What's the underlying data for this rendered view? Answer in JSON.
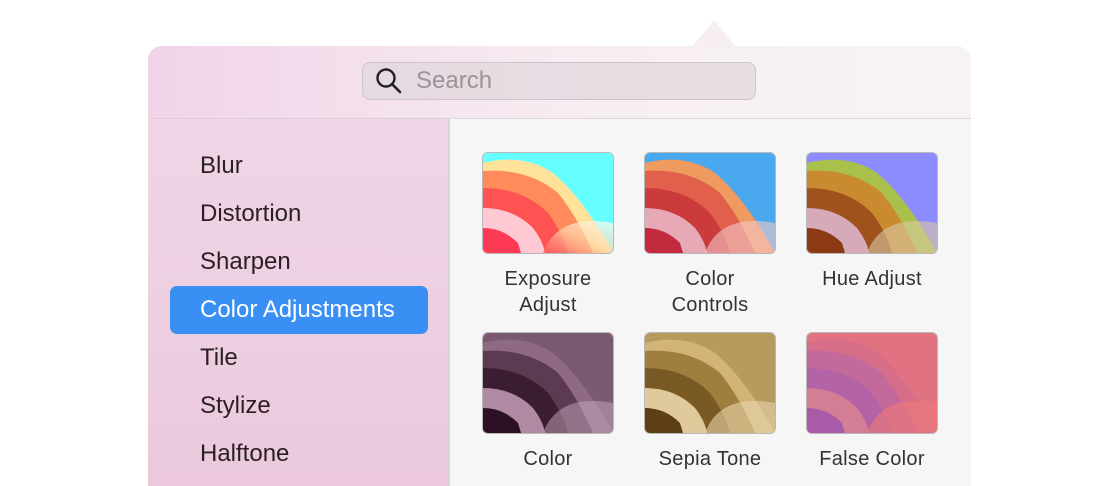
{
  "search": {
    "placeholder": "Search",
    "value": ""
  },
  "sidebar": {
    "items": [
      {
        "label": "Blur",
        "selected": false
      },
      {
        "label": "Distortion",
        "selected": false
      },
      {
        "label": "Sharpen",
        "selected": false
      },
      {
        "label": "Color Adjustments",
        "selected": true
      },
      {
        "label": "Tile",
        "selected": false
      },
      {
        "label": "Stylize",
        "selected": false
      },
      {
        "label": "Halftone",
        "selected": false
      }
    ]
  },
  "filters": [
    {
      "label": "Exposure\nAdjust"
    },
    {
      "label": "Color\nControls"
    },
    {
      "label": "Hue Adjust"
    },
    {
      "label": "Color"
    },
    {
      "label": "Sepia Tone"
    },
    {
      "label": "False Color"
    }
  ],
  "colors": {
    "accent": "#3a8ff5"
  }
}
